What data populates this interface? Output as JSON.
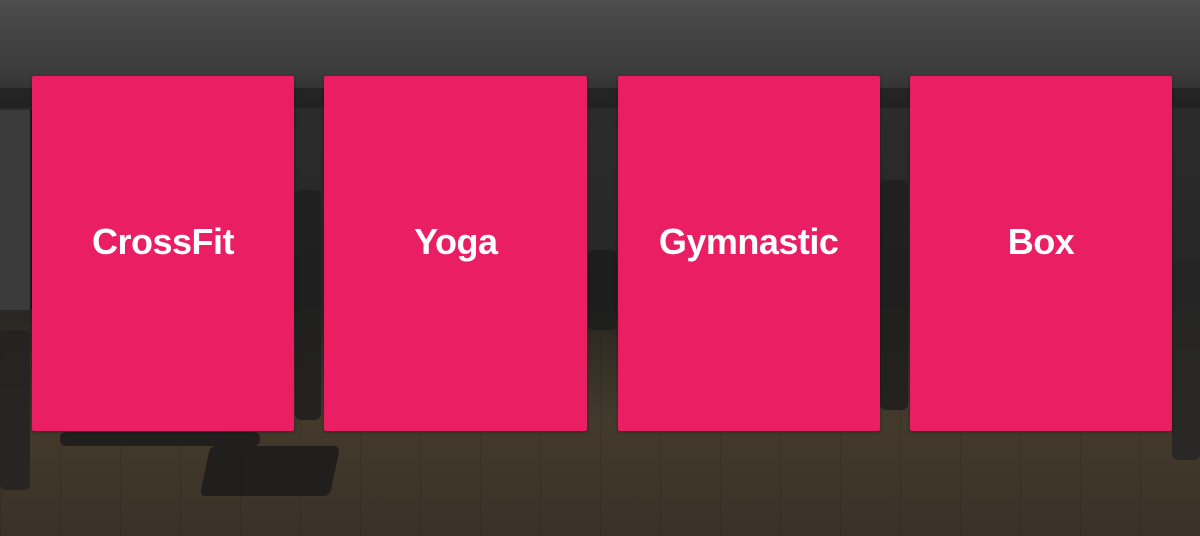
{
  "categories": [
    {
      "label": "CrossFit"
    },
    {
      "label": "Yoga"
    },
    {
      "label": "Gymnastic"
    },
    {
      "label": "Box"
    }
  ],
  "colors": {
    "card_background": "#e91e63",
    "card_text": "#ffffff"
  }
}
